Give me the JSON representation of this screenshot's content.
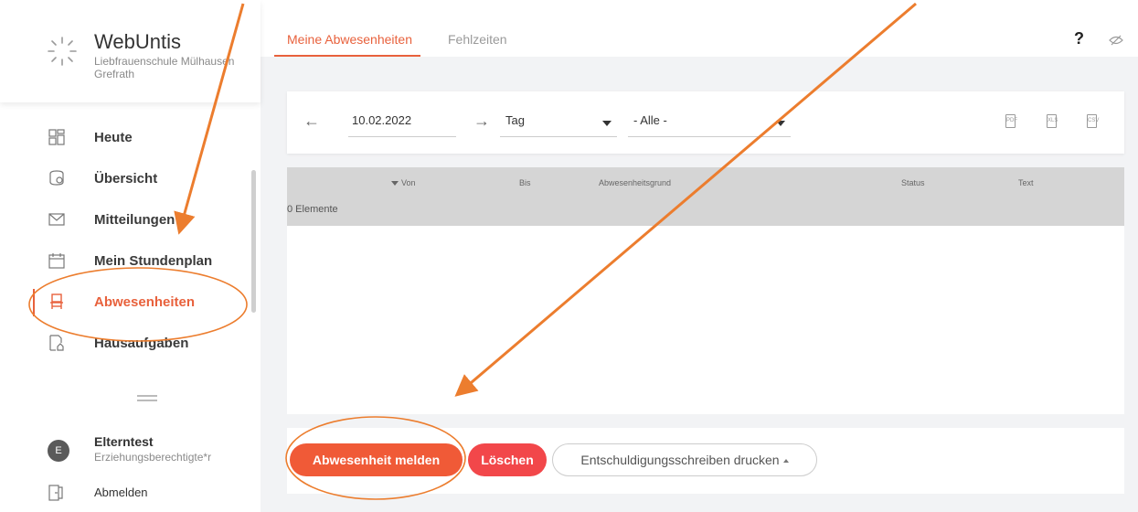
{
  "app": {
    "brand": "WebUntis",
    "school_line1": "Liebfrauenschule Mülhausen",
    "school_line2": "Grefrath"
  },
  "sidebar": {
    "items": [
      {
        "label": "Heute",
        "icon": "dashboard-icon"
      },
      {
        "label": "Übersicht",
        "icon": "overview-icon"
      },
      {
        "label": "Mitteilungen",
        "icon": "mail-icon"
      },
      {
        "label": "Mein Stundenplan",
        "icon": "calendar-icon"
      },
      {
        "label": "Abwesenheiten",
        "icon": "chair-icon",
        "active": true
      },
      {
        "label": "Hausaufgaben",
        "icon": "homework-icon"
      }
    ],
    "user": {
      "initial": "E",
      "name": "Elterntest",
      "role": "Erziehungsberechtigte*r"
    },
    "logout_label": "Abmelden"
  },
  "header": {
    "tabs": [
      {
        "label": "Meine Abwesenheiten",
        "active": true
      },
      {
        "label": "Fehlzeiten"
      }
    ],
    "help": "?"
  },
  "toolbar": {
    "date": "10.02.2022",
    "period": "Tag",
    "filter": "- Alle -",
    "exports": [
      "PDF",
      "XLS",
      "CSV"
    ]
  },
  "table": {
    "columns": [
      "Von",
      "Bis",
      "Abwesenheitsgrund",
      "Status",
      "Text"
    ],
    "count": "0 Elemente"
  },
  "actions": {
    "report": "Abwesenheit melden",
    "delete": "Löschen",
    "print": "Entschuldigungsschreiben drucken"
  },
  "colors": {
    "accent": "#e8613c",
    "primary_button": "#f05a37",
    "delete_button": "#f2474a",
    "annotation": "#ec7d2e"
  }
}
